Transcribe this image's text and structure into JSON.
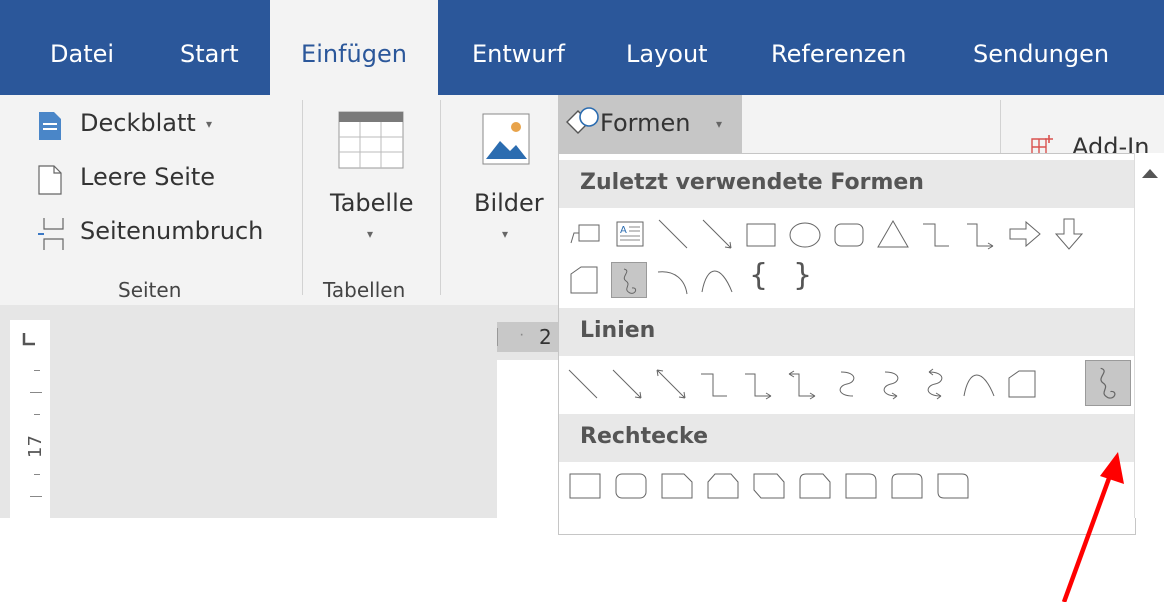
{
  "tabs": [
    {
      "label": "Datei"
    },
    {
      "label": "Start"
    },
    {
      "label": "Einfügen"
    },
    {
      "label": "Entwurf"
    },
    {
      "label": "Layout"
    },
    {
      "label": "Referenzen"
    },
    {
      "label": "Sendungen"
    }
  ],
  "ribbon": {
    "pages": {
      "deckblatt": "Deckblatt",
      "leere_seite": "Leere Seite",
      "seitenumbruch": "Seitenumbruch",
      "group_label": "Seiten"
    },
    "tables": {
      "tabelle": "Tabelle",
      "group_label": "Tabellen"
    },
    "bilder": "Bilder",
    "formen": "Formen",
    "addins": "Add-In"
  },
  "ruler": {
    "vertical_label": "17",
    "horizontal_label": "2"
  },
  "shapes_menu": {
    "sections": [
      {
        "title": "Zuletzt verwendete Formen"
      },
      {
        "title": "Linien"
      },
      {
        "title": "Rechtecke"
      }
    ],
    "recent_braces": [
      "{",
      "}"
    ]
  },
  "colors": {
    "tab_bar": "#2b579a",
    "ribbon": "#f3f3f3",
    "arrow": "#ff0000"
  }
}
